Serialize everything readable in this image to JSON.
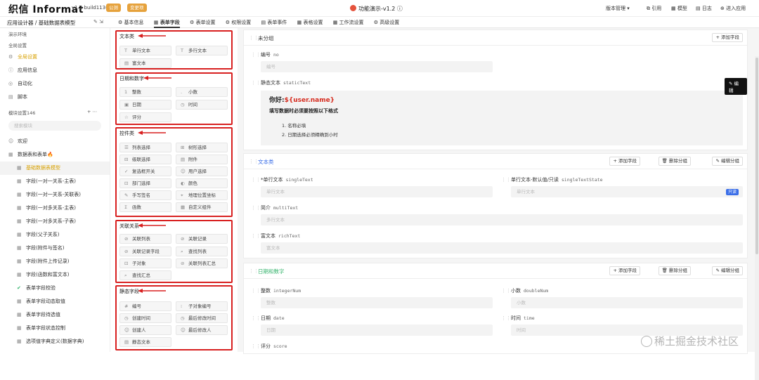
{
  "topbar": {
    "logo": "织信 Informat",
    "version": "v1.2 build1136",
    "badge1": "公测",
    "badge2": "变更项",
    "app_title": "功能演示-v1.2",
    "right": [
      "版本管理",
      "引用",
      "模型",
      "日志",
      "进入应用"
    ]
  },
  "subbar": {
    "breadcrumb": "应用设计器 / 基础数据表模型",
    "tabs": [
      "基本信息",
      "表单字段",
      "表单设置",
      "权限设置",
      "表单事件",
      "表格设置",
      "工作流设置",
      "高级设置"
    ],
    "active_tab": "表单字段"
  },
  "sidebar": {
    "env": "演示环境",
    "global_settings": "全局设置",
    "items": [
      "全局设置",
      "应用信息",
      "自动化",
      "脚本"
    ],
    "module_header": "模块设置146",
    "search_placeholder": "搜索模块",
    "welcome": "欢迎",
    "folder": "数据表和表单🔥",
    "subitems": [
      "基础数据表模型",
      "字段(一对一关系-主表)",
      "字段(一对一关系-关联表)",
      "字段(一对多关系-主表)",
      "字段(一对多关系-子表)",
      "字段(父子关系)",
      "字段(附件与签名)",
      "字段(附件上传记录)",
      "字段(函数和富文本)",
      "表单字段校验",
      "表单字段动态取值",
      "表单字段待选值",
      "表单字段状态控制",
      "选项值字典定义(数据字典)"
    ]
  },
  "palette": {
    "groups": [
      {
        "title": "文本类",
        "items": [
          "单行文本",
          "多行文本",
          "富文本"
        ]
      },
      {
        "title": "日期和数字",
        "items": [
          "整数",
          "小数",
          "日期",
          "时间",
          "评分"
        ]
      },
      {
        "title": "控件类",
        "items": [
          "列表选择",
          "树形选择",
          "级联选择",
          "附件",
          "复选框开关",
          "用户选择",
          "部门选择",
          "颜色",
          "手写签名",
          "地理位置坐标",
          "函数",
          "自定义组件"
        ]
      },
      {
        "title": "关联关系",
        "items": [
          "关联列表",
          "关联记录",
          "关联记录字段",
          "查找列表",
          "子对象",
          "关联列表汇总",
          "查找汇总"
        ]
      },
      {
        "title": "静态字段",
        "items": [
          "编号",
          "子对象编号",
          "创建时间",
          "最后修改时间",
          "创建人",
          "最后修改人",
          "静态文本"
        ]
      }
    ]
  },
  "main": {
    "ungrouped": {
      "title": "未分组",
      "add": "+ 添加字段",
      "f_no_label": "编号",
      "f_no_code": "no",
      "f_no_ph": "编号",
      "f_static_label": "静态文本",
      "f_static_code": "staticText",
      "rich_line1_pre": "你好:",
      "rich_line1_var": "${user.name}",
      "rich_line2": "填写数据时必须要按照以下格式",
      "rich_list": [
        "1. 名称必填",
        "2. 日期选择必须精确到小时"
      ],
      "edit": "编辑"
    },
    "text_group": {
      "title": "文本类",
      "btns": [
        "+ 添加字段",
        "删除分组",
        "编辑分组"
      ],
      "f1_label": "*单行文本",
      "f1_code": "singleText",
      "f1_ph": "单行文本",
      "f2_label": "单行文本-默认值/只读",
      "f2_code": "singleTextState",
      "f2_ph": "单行文本",
      "f2_tag": "只读",
      "f3_label": "简介",
      "f3_code": "multiText",
      "f3_ph": "多行文本",
      "f4_label": "富文本",
      "f4_code": "richText",
      "f4_ph": "富文本"
    },
    "date_group": {
      "title": "日期和数字",
      "btns": [
        "+ 添加字段",
        "删除分组",
        "编辑分组"
      ],
      "f1_label": "整数",
      "f1_code": "integerNum",
      "f1_ph": "整数",
      "f2_label": "小数",
      "f2_code": "doubleNum",
      "f2_ph": "小数",
      "f3_label": "日期",
      "f3_code": "date",
      "f3_ph": "日期",
      "f4_label": "时间",
      "f4_code": "time",
      "f4_ph": "时间",
      "f5_label": "评分",
      "f5_code": "score"
    }
  },
  "watermark": "稀土掘金技术社区"
}
